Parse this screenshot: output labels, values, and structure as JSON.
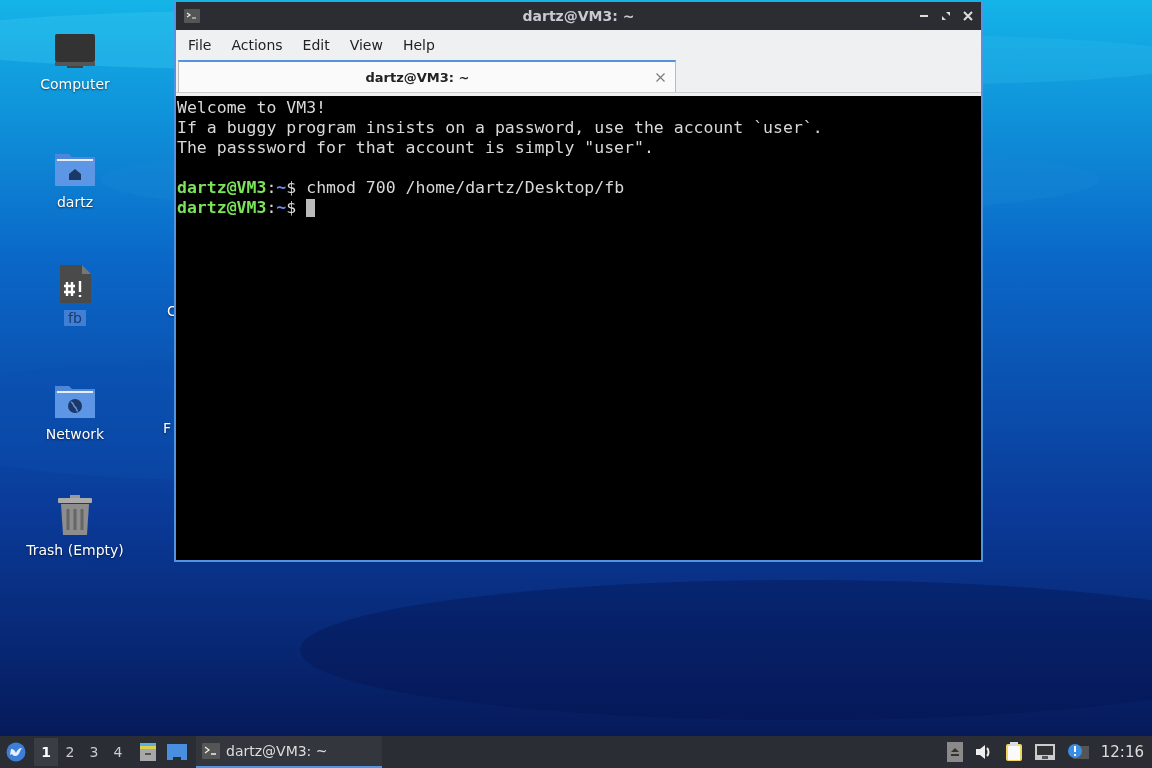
{
  "desktop_icons": [
    {
      "kind": "computer",
      "label": "Computer",
      "selected": false
    },
    {
      "kind": "home",
      "label": "dartz",
      "selected": false
    },
    {
      "kind": "script",
      "label": "fb",
      "selected": true
    },
    {
      "kind": "network",
      "label": "Network",
      "selected": false
    },
    {
      "kind": "trash",
      "label": "Trash (Empty)",
      "selected": false
    }
  ],
  "hidden_icon_labels": [
    "C",
    "F"
  ],
  "window": {
    "title": "dartz@VM3: ~",
    "menu": [
      "File",
      "Actions",
      "Edit",
      "View",
      "Help"
    ],
    "tabs": [
      {
        "label": "dartz@VM3: ~",
        "selected": true
      }
    ],
    "terminal": [
      {
        "kind": "text",
        "text": "Welcome to VM3!"
      },
      {
        "kind": "text",
        "text": "If a buggy program insists on a password, use the account `user`."
      },
      {
        "kind": "text",
        "text": "The passsword for that account is simply \"user\"."
      },
      {
        "kind": "blank"
      },
      {
        "kind": "prompt",
        "user": "dartz@VM3",
        "sep": ":",
        "path": "~",
        "symbol": "$",
        "command": "chmod 700 /home/dartz/Desktop/fb",
        "cursor": false
      },
      {
        "kind": "prompt",
        "user": "dartz@VM3",
        "sep": ":",
        "path": "~",
        "symbol": "$",
        "cursor": true
      }
    ]
  },
  "taskbar": {
    "workspaces": [
      {
        "label": "1",
        "selected": true
      },
      {
        "label": "2",
        "selected": false
      },
      {
        "label": "3",
        "selected": false
      },
      {
        "label": "4",
        "selected": false
      }
    ],
    "tasks": [
      {
        "label": "dartz@VM3: ~",
        "selected": true
      }
    ],
    "clock": "12:16"
  }
}
